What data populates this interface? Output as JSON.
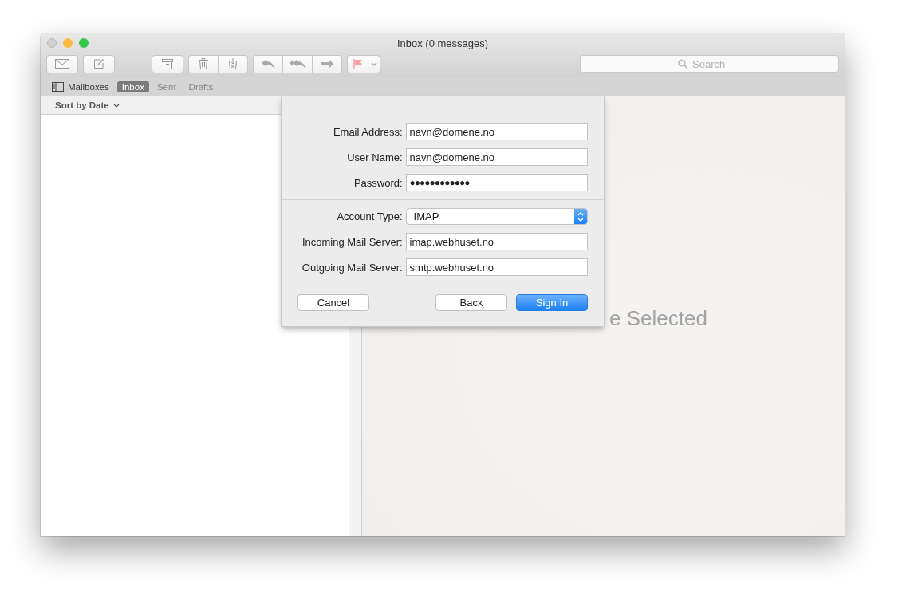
{
  "window": {
    "title": "Inbox (0 messages)"
  },
  "toolbar": {
    "search": {
      "placeholder": "Search"
    }
  },
  "tabs": [
    {
      "label": "Mailboxes",
      "kind": "sidebar",
      "selected": false
    },
    {
      "label": "Inbox",
      "kind": "mailbox",
      "selected": true
    },
    {
      "label": "Sent",
      "kind": "mailbox",
      "selected": false
    },
    {
      "label": "Drafts",
      "kind": "mailbox",
      "selected": false
    }
  ],
  "message_list": {
    "sort": "Sort by Date"
  },
  "viewer": {
    "message": "e Selected"
  },
  "sheet": {
    "fields": [
      {
        "label": "Email Address:",
        "kind": "text",
        "value": "navn@domene.no"
      },
      {
        "label": "User Name:",
        "kind": "text",
        "value": "navn@domene.no"
      },
      {
        "label": "Password:",
        "kind": "password",
        "value": "●●●●●●●●●●●●"
      },
      {
        "label": "Account Type:",
        "kind": "popup",
        "value": "IMAP"
      },
      {
        "label": "Incoming Mail Server:",
        "kind": "text",
        "value": "imap.webhuset.no"
      },
      {
        "label": "Outgoing Mail Server:",
        "kind": "text",
        "value": "smtp.webhuset.no"
      }
    ],
    "buttons": [
      {
        "label": "Cancel",
        "kind": "plain"
      },
      {
        "label": "Back",
        "kind": "plain"
      },
      {
        "label": "Sign In",
        "kind": "default"
      }
    ]
  }
}
